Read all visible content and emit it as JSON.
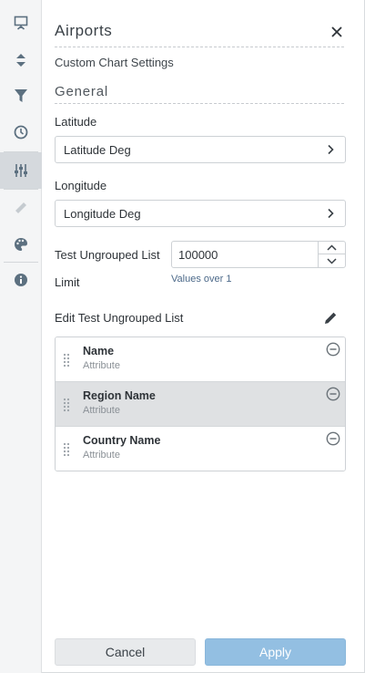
{
  "rail": {
    "items": [
      {
        "icon": "presentation-icon",
        "active": false
      },
      {
        "icon": "sort-icon",
        "active": false
      },
      {
        "icon": "filter-icon",
        "active": false
      },
      {
        "icon": "clock-icon",
        "active": false
      },
      {
        "icon": "sliders-icon",
        "active": true
      },
      {
        "icon": "ruler-icon",
        "active": false,
        "disabled": true
      },
      {
        "icon": "palette-icon",
        "active": false
      },
      {
        "icon": "info-icon",
        "active": false
      }
    ]
  },
  "panel": {
    "title": "Airports",
    "subtitle": "Custom Chart Settings",
    "section": "General",
    "latitude": {
      "label": "Latitude",
      "value": "Latitude Deg"
    },
    "longitude": {
      "label": "Longitude",
      "value": "Longitude Deg"
    },
    "limit": {
      "label_line1": "Test Ungrouped List",
      "label_line2": "Limit",
      "value": "100000",
      "hint": "Values over 1"
    },
    "edit_list": {
      "label": "Edit Test Ungrouped List",
      "items": [
        {
          "name": "Name",
          "type": "Attribute",
          "highlighted": false
        },
        {
          "name": "Region Name",
          "type": "Attribute",
          "highlighted": true
        },
        {
          "name": "Country Name",
          "type": "Attribute",
          "highlighted": false
        }
      ]
    },
    "buttons": {
      "cancel": "Cancel",
      "apply": "Apply"
    }
  },
  "colors": {
    "accent": "#93bfe2",
    "rail_bg": "#f4f5f6",
    "rail_active": "#d5d9dd",
    "hint": "#4d6a8a"
  }
}
